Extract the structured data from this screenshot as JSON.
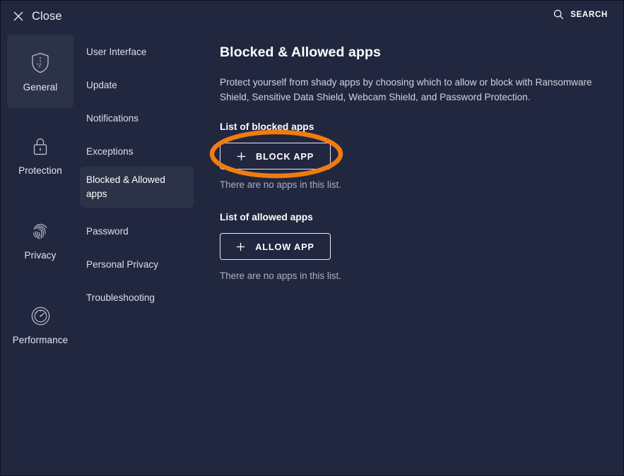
{
  "window": {
    "background_color": "#222740",
    "accent_highlight_color": "#f07c10",
    "active_item_color": "#2c3349"
  },
  "titlebar": {
    "close_label": "Close",
    "close_icon": "close-x-icon",
    "search_label": "SEARCH",
    "search_icon": "search-icon"
  },
  "sidebar": {
    "items": [
      {
        "label": "General",
        "icon": "shield-icon",
        "active": true
      },
      {
        "label": "Protection",
        "icon": "lock-icon",
        "active": false
      },
      {
        "label": "Privacy",
        "icon": "fingerprint-icon",
        "active": false
      },
      {
        "label": "Performance",
        "icon": "gauge-icon",
        "active": false
      }
    ]
  },
  "subnav": {
    "items": [
      {
        "label": "User Interface",
        "active": false
      },
      {
        "label": "Update",
        "active": false
      },
      {
        "label": "Notifications",
        "active": false
      },
      {
        "label": "Exceptions",
        "active": false
      },
      {
        "label": "Blocked & Allowed apps",
        "active": true
      },
      {
        "label": "Password",
        "active": false
      },
      {
        "label": "Personal Privacy",
        "active": false
      },
      {
        "label": "Troubleshooting",
        "active": false
      }
    ]
  },
  "main": {
    "title": "Blocked & Allowed apps",
    "description": "Protect yourself from shady apps by choosing which to allow or block with Ransomware Shield, Sensitive Data Shield, Webcam Shield, and Password Protection.",
    "blocked": {
      "heading": "List of blocked apps",
      "button_label": "BLOCK APP",
      "button_icon": "plus-icon",
      "empty_text": "There are no apps in this list."
    },
    "allowed": {
      "heading": "List of allowed apps",
      "button_label": "ALLOW APP",
      "button_icon": "plus-icon",
      "empty_text": "There are no apps in this list."
    }
  },
  "annotation": {
    "shape": "ellipse-highlight",
    "color": "#f07c10",
    "target": "BLOCK APP"
  }
}
